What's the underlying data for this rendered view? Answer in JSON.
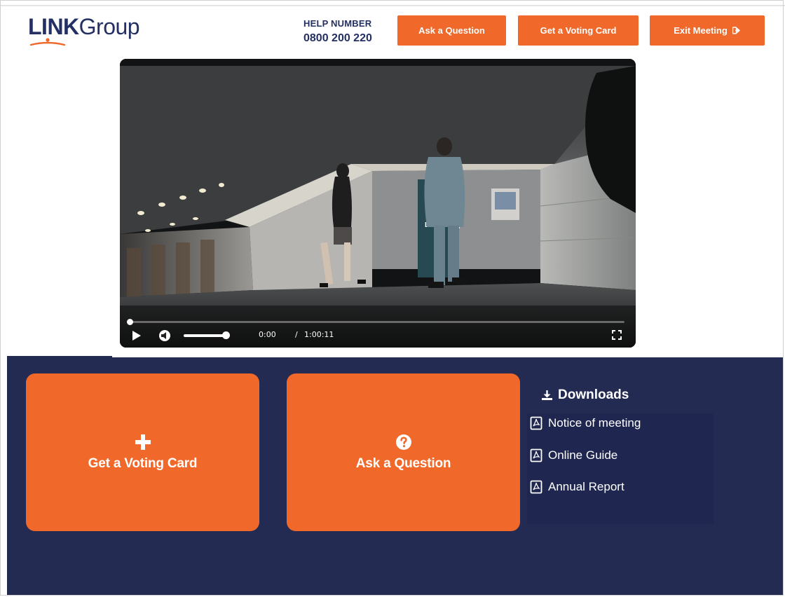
{
  "header": {
    "logo": {
      "bold": "LINK",
      "light": "Group"
    },
    "help_label": "HELP NUMBER",
    "help_number": "0800 200 220",
    "ask_button": "Ask a Question",
    "voting_button": "Get a Voting Card",
    "exit_button": "Exit Meeting"
  },
  "video": {
    "current_time": "0:00",
    "separator": "/",
    "duration": "1:00:11",
    "progress": 0,
    "volume": 1.0
  },
  "tiles": {
    "voting_card": "Get a Voting Card",
    "ask_question": "Ask a Question"
  },
  "downloads": {
    "title": "Downloads",
    "items": [
      {
        "label": "Notice of meeting"
      },
      {
        "label": "Online Guide"
      },
      {
        "label": "Annual Report"
      }
    ]
  },
  "colors": {
    "brand_orange": "#f0682a",
    "navy": "#232b52",
    "logo_navy": "#243063"
  }
}
